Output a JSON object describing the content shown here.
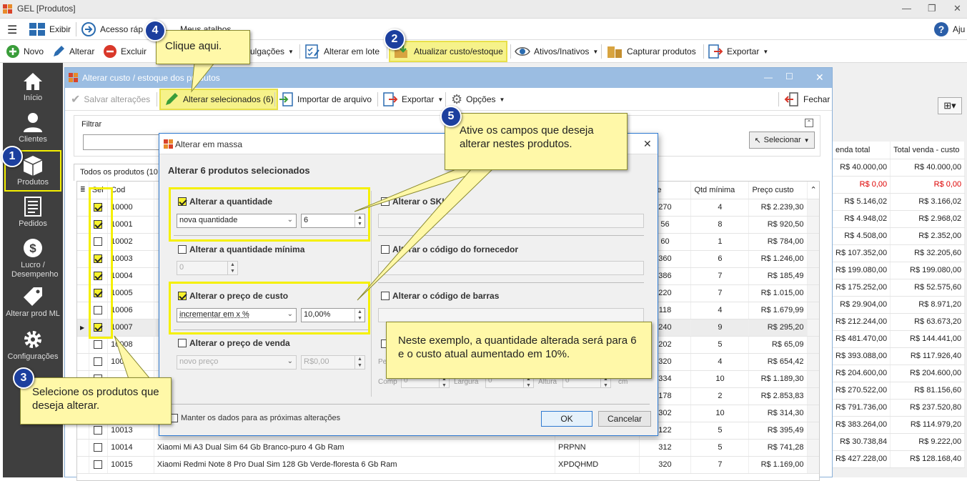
{
  "app": {
    "title": "GEL [Produtos]",
    "help_label": "Aju"
  },
  "menubar": {
    "exibir": "Exibir",
    "acesso": "Acesso ráp",
    "atalhos": "Meus atalhos"
  },
  "toolbar": {
    "novo": "Novo",
    "alterar": "Alterar",
    "excluir": "Excluir",
    "divulgacoes": "vulgações",
    "alterar_lote": "Alterar em lote",
    "atualizar": "Atualizar custo/estoque",
    "ativos": "Ativos/Inativos",
    "capturar": "Capturar produtos",
    "exportar": "Exportar"
  },
  "sidebar": {
    "items": [
      "Início",
      "Clientes",
      "Produtos",
      "Pedidos",
      "Lucro / Desempenho",
      "Alterar prod ML",
      "Configurações"
    ]
  },
  "subwindow": {
    "title": "Alterar custo / estoque dos produtos",
    "salvar": "Salvar alterações",
    "alterar_sel": "Alterar selecionados (6)",
    "importar": "Importar de arquivo",
    "exportar": "Exportar",
    "opcoes": "Opções",
    "fechar": "Fechar",
    "filtrar": "Filtrar",
    "selecionar": "Selecionar",
    "tab": "Todos os produtos (10",
    "headers": {
      "sel": "Sel",
      "cod": "Cod",
      "qtd": "idade",
      "qtd_min": "Qtd mínima",
      "preco_custo": "Preço custo"
    }
  },
  "rows": [
    {
      "sel": true,
      "cod": "10000",
      "desc": "",
      "sku": "",
      "qtd": "270",
      "qmin": "4",
      "custo": "R$ 2.239,30"
    },
    {
      "sel": true,
      "cod": "10001",
      "desc": "",
      "sku": "",
      "qtd": "56",
      "qmin": "8",
      "custo": "R$ 920,50"
    },
    {
      "sel": false,
      "cod": "10002",
      "desc": "",
      "sku": "",
      "qtd": "60",
      "qmin": "1",
      "custo": "R$ 784,00"
    },
    {
      "sel": true,
      "cod": "10003",
      "desc": "",
      "sku": "",
      "qtd": "360",
      "qmin": "6",
      "custo": "R$ 1.246,00"
    },
    {
      "sel": true,
      "cod": "10004",
      "desc": "",
      "sku": "",
      "qtd": "386",
      "qmin": "7",
      "custo": "R$ 185,49"
    },
    {
      "sel": true,
      "cod": "10005",
      "desc": "",
      "sku": "",
      "qtd": "220",
      "qmin": "7",
      "custo": "R$ 1.015,00"
    },
    {
      "sel": false,
      "cod": "10006",
      "desc": "",
      "sku": "",
      "qtd": "118",
      "qmin": "4",
      "custo": "R$ 1.679,99"
    },
    {
      "sel": true,
      "cod": "10007",
      "desc": "",
      "sku": "",
      "qtd": "240",
      "qmin": "9",
      "custo": "R$ 295,20"
    },
    {
      "sel": false,
      "cod": "10008",
      "desc": "",
      "sku": "",
      "qtd": "202",
      "qmin": "5",
      "custo": "R$ 65,09"
    },
    {
      "sel": false,
      "cod": "10009",
      "desc": "",
      "sku": "",
      "qtd": "320",
      "qmin": "4",
      "custo": "R$ 654,42"
    },
    {
      "sel": false,
      "cod": "",
      "desc": "",
      "sku": "",
      "qtd": "334",
      "qmin": "10",
      "custo": "R$ 1.189,30"
    },
    {
      "sel": false,
      "cod": "",
      "desc": "",
      "sku": "",
      "qtd": "178",
      "qmin": "2",
      "custo": "R$ 2.853,83"
    },
    {
      "sel": false,
      "cod": "",
      "desc": "",
      "sku": "",
      "qtd": "302",
      "qmin": "10",
      "custo": "R$ 314,30"
    },
    {
      "sel": false,
      "cod": "10013",
      "desc": "",
      "sku": "",
      "qtd": "122",
      "qmin": "5",
      "custo": "R$ 395,49"
    },
    {
      "sel": false,
      "cod": "10014",
      "desc": "Xiaomi Mi A3 Dual Sim 64 Gb Branco-puro 4 Gb Ram",
      "sku": "PRPNN",
      "qtd": "312",
      "qmin": "5",
      "custo": "R$ 741,28"
    },
    {
      "sel": false,
      "cod": "10015",
      "desc": "Xiaomi Redmi Note 8 Pro Dual Sim 128 Gb Verde-floresta 6 Gb Ram",
      "sku": "XPDQHMD",
      "qtd": "320",
      "qmin": "7",
      "custo": "R$ 1.169,00"
    }
  ],
  "right_table": {
    "headers": [
      "enda total",
      "Total venda - custo"
    ],
    "rows": [
      [
        "R$ 40.000,00",
        "R$ 40.000,00"
      ],
      [
        "R$ 0,00",
        "R$ 0,00"
      ],
      [
        "R$ 5.146,02",
        "R$ 3.166,02"
      ],
      [
        "R$ 4.948,02",
        "R$ 2.968,02"
      ],
      [
        "R$ 4.508,00",
        "R$ 2.352,00"
      ],
      [
        "R$ 107.352,00",
        "R$ 32.205,60"
      ],
      [
        "R$ 199.080,00",
        "R$ 199.080,00"
      ],
      [
        "R$ 175.252,00",
        "R$ 52.575,60"
      ],
      [
        "R$ 29.904,00",
        "R$ 8.971,20"
      ],
      [
        "R$ 212.244,00",
        "R$ 63.673,20"
      ],
      [
        "R$ 481.470,00",
        "R$ 144.441,00"
      ],
      [
        "R$ 393.088,00",
        "R$ 117.926,40"
      ],
      [
        "R$ 204.600,00",
        "R$ 204.600,00"
      ],
      [
        "R$ 270.522,00",
        "R$ 81.156,60"
      ],
      [
        "R$ 791.736,00",
        "R$ 237.520,80"
      ],
      [
        "R$ 383.264,00",
        "R$ 114.979,20"
      ],
      [
        "R$ 30.738,84",
        "R$ 9.222,00"
      ],
      [
        "R$ 427.228,00",
        "R$ 128.168,40"
      ]
    ]
  },
  "dialog": {
    "title": "Alterar em massa",
    "heading": "Alterar 6 produtos selecionados",
    "alt_qtd": "Alterar a quantidade",
    "qtd_mode": "nova quantidade",
    "qtd_value": "6",
    "alt_qtd_min": "Alterar a quantidade mínima",
    "qtd_min_value": "0",
    "alt_custo": "Alterar o preço de custo",
    "custo_mode": "incrementar em x %",
    "custo_value": "10,00%",
    "alt_venda": "Alterar o preço de venda",
    "venda_mode": "novo preço",
    "venda_value": "R$0,00",
    "alt_sku": "Alterar o SKU",
    "alt_forn": "Alterar o código do fornecedor",
    "alt_barras": "Alterar o código de barras",
    "pe": "Pe",
    "comp": "Comp",
    "largura": "Largura",
    "altura": "Altura",
    "cm": "cm",
    "dim_value": "0",
    "manter": "Manter os dados para as próximas alterações",
    "ok": "OK",
    "cancelar": "Cancelar"
  },
  "callouts": {
    "c4": "Clique aqui.",
    "c5": "Ative os campos que deseja alterar nestes produtos.",
    "c3": "Selecione os produtos que deseja alterar.",
    "example": "Neste exemplo, a quantidade alterada será para 6 e o custo atual aumentado em 10%."
  },
  "badges": [
    "1",
    "2",
    "3",
    "4",
    "5"
  ]
}
